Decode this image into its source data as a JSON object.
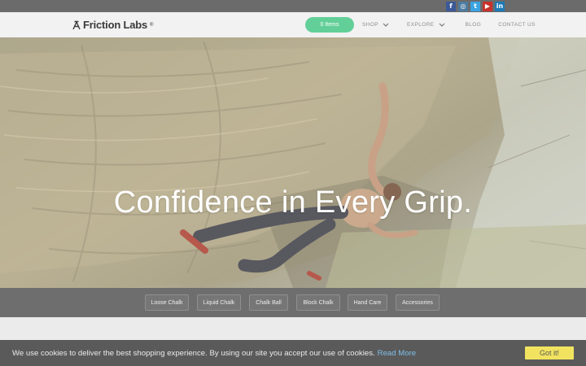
{
  "social": {
    "icons": [
      {
        "name": "facebook-icon",
        "glyph": "f",
        "color": "#3b5998"
      },
      {
        "name": "instagram-icon",
        "glyph": "◎",
        "color": "#4e7ba0"
      },
      {
        "name": "twitter-icon",
        "glyph": "t",
        "color": "#3aa4e3"
      },
      {
        "name": "youtube-icon",
        "glyph": "▶",
        "color": "#c8312b"
      },
      {
        "name": "linkedin-icon",
        "glyph": "in",
        "color": "#1d7ab6"
      }
    ]
  },
  "header": {
    "logo_text": "Friction Labs",
    "logo_reg": "®",
    "cart_label": "0 Items",
    "nav": {
      "shop": "SHOP",
      "explore": "EXPLORE",
      "blog": "BLOG",
      "contact": "CONTACT US"
    }
  },
  "hero": {
    "title": "Confidence in Every Grip."
  },
  "categories": [
    "Loose Chalk",
    "Liquid Chalk",
    "Chalk Ball",
    "Block Chalk",
    "Hand Care",
    "Accessories"
  ],
  "cookie": {
    "message": "We use cookies to deliver the best shopping experience. By using our site you accept our use of cookies.",
    "link_label": "Read More",
    "accept_label": "Got it!"
  },
  "colors": {
    "accent_green": "#63cf98",
    "cookie_button": "#f1e35f",
    "cookie_link": "#7fbfe8"
  }
}
